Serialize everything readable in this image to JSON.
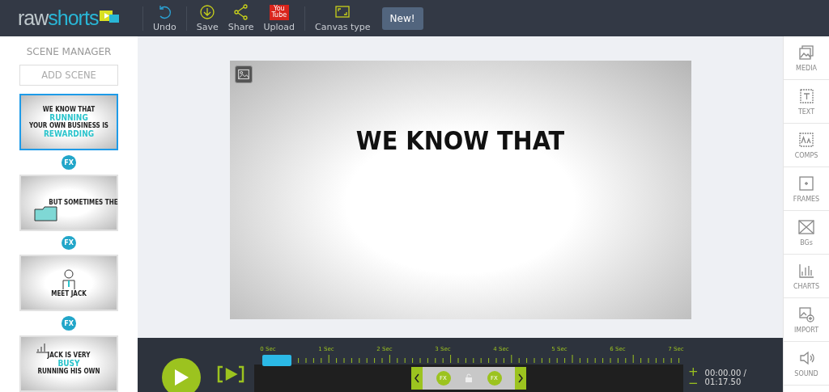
{
  "toolbar": {
    "logo": {
      "part1": "raw",
      "part2": "shorts"
    },
    "actions": [
      {
        "kind": "undo",
        "label": "Undo"
      },
      {
        "kind": "save",
        "label": "Save"
      },
      {
        "kind": "share",
        "label": "Share"
      },
      {
        "kind": "upload",
        "label": "Upload",
        "badge": "You Tube"
      },
      {
        "kind": "canvas",
        "label": "Canvas type"
      }
    ],
    "tooltip": "New!"
  },
  "scene_manager": {
    "title": "SCENE MANAGER",
    "add_button": "ADD SCENE",
    "scenes": [
      {
        "selected": true,
        "kind": "title",
        "lines": [
          "WE KNOW THAT",
          "RUNNING",
          "YOUR OWN BUSINESS IS",
          "REWARDING"
        ]
      },
      {
        "fx_label": "FX",
        "selected": false,
        "kind": "folder",
        "lines": [
          "BUT SOMETIMES THE"
        ]
      },
      {
        "fx_label": "FX",
        "selected": false,
        "kind": "person",
        "lines": [
          "MEET JACK"
        ]
      },
      {
        "fx_label": "FX",
        "selected": false,
        "kind": "busy",
        "lines": [
          "JACK IS VERY",
          "BUSY",
          "RUNNING HIS OWN"
        ]
      }
    ]
  },
  "canvas": {
    "text": "WE KNOW THAT"
  },
  "right_rail": [
    {
      "kind": "media",
      "label": "MEDIA"
    },
    {
      "kind": "text",
      "label": "TEXT"
    },
    {
      "kind": "comps",
      "label": "COMPS"
    },
    {
      "kind": "frames",
      "label": "FRAMES"
    },
    {
      "kind": "bgs",
      "label": "BGs"
    },
    {
      "kind": "charts",
      "label": "CHARTS"
    },
    {
      "kind": "import",
      "label": "IMPORT"
    },
    {
      "kind": "sound",
      "label": "SOUND"
    }
  ],
  "timeline": {
    "ticks": [
      "0 Sec",
      "1 Sec",
      "2 Sec",
      "3 Sec",
      "4 Sec",
      "5 Sec",
      "6 Sec",
      "7 Sec"
    ],
    "clip": {
      "fx_in": "FX",
      "fx_out": "FX",
      "locked": false
    },
    "zoom_in": "+",
    "zoom_out": "−",
    "time_current": "00:00.00 /",
    "time_total": "01:17.50"
  }
}
